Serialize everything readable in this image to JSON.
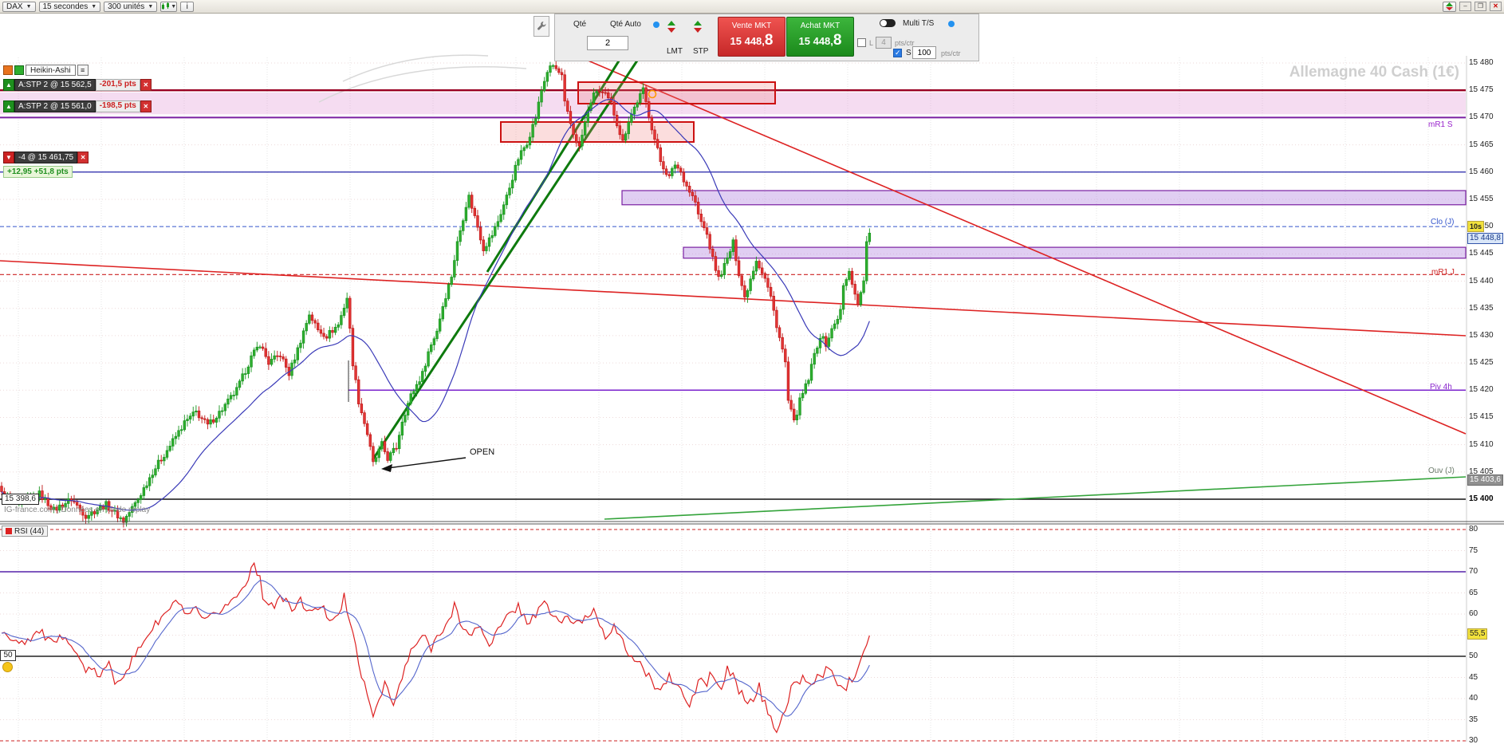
{
  "toolbar": {
    "symbol": "DAX",
    "timeframe": "15 secondes",
    "units": "300 unités",
    "info_button": "i"
  },
  "window_controls": {
    "minimize": "–",
    "restore": "❐",
    "close": "✕"
  },
  "trade_panel": {
    "qty_label": "Qté",
    "qty_value": "2",
    "qty_auto_label": "Qté Auto",
    "lmt_label": "LMT",
    "stp_label": "STP",
    "sell_button": {
      "label": "Vente MKT",
      "price": "15 448,",
      "price_big": "8"
    },
    "buy_button": {
      "label": "Achat MKT",
      "price": "15 448,",
      "price_big": "8"
    },
    "limit": {
      "label": "L",
      "value": "4",
      "unit": "pts/ctr"
    },
    "multi_ts_label": "Multi T/S",
    "stop": {
      "label": "S",
      "value": "100",
      "unit": "pts/ctr"
    }
  },
  "chart": {
    "style_button": "Heikin-Ashi",
    "watermark": "Allemagne 40 Cash (1€)",
    "positions": [
      {
        "label": "A:STP 2 @ 15 562,5",
        "pnl": "-201,5 pts"
      },
      {
        "label": "A:STP 2 @ 15 561,0",
        "pnl": "-198,5 pts"
      }
    ],
    "closed_position": "-4 @ 15 461,75",
    "session_pnl": "+12,95 +51,8 pts",
    "open_label": "OPEN",
    "left_price_box": "15 398,6",
    "countdown": "10s",
    "last_price": "15 448,8",
    "open_price": "15 403,6",
    "footer": "IG-france.com | Données en mode replay",
    "labels": {
      "mr1s": "mR1 S",
      "clo": "Clo (J)",
      "mr1j": "mR1 J",
      "piv": "Piv 4h",
      "ouv": "Ouv (J)"
    }
  },
  "rsi_panel": {
    "label": "RSI (44)",
    "left_level": "50",
    "current": "55,5"
  },
  "chart_data": {
    "type": "candlestick",
    "title": "Allemagne 40 Cash (1€) — DAX 15 secondes Heikin-Ashi 300 unités with RSI(44)",
    "price_ticks": [
      15480,
      15475,
      15470,
      15465,
      15460,
      15455,
      15450,
      15445,
      15440,
      15435,
      15430,
      15425,
      15420,
      15415,
      15410,
      15405,
      15400
    ],
    "rsi_ticks": [
      80,
      75,
      70,
      65,
      60,
      55,
      50,
      45,
      40,
      35,
      30
    ],
    "candle_count": 300,
    "levels": {
      "dark_red": 15475,
      "mr1_s": 15470,
      "blue": 15460,
      "clo_j": 15450,
      "last": 15448.8,
      "mr1_j": 15441.2,
      "piv_4h": 15420,
      "ouv_j": 15403.6,
      "black": 15400
    },
    "rsi_levels": {
      "upper_red": 80,
      "purple": 70,
      "mid": 50,
      "lower_red": 30,
      "current": 55.5
    },
    "price_path": [
      [
        0,
        15401
      ],
      [
        6,
        15399
      ],
      [
        13,
        15401
      ],
      [
        18,
        15398
      ],
      [
        24,
        15400
      ],
      [
        29,
        15397
      ],
      [
        36,
        15399
      ],
      [
        42,
        15396
      ],
      [
        47,
        15400
      ],
      [
        52,
        15405
      ],
      [
        57,
        15409
      ],
      [
        63,
        15414
      ],
      [
        67,
        15416
      ],
      [
        71,
        15413.5
      ],
      [
        76,
        15416.5
      ],
      [
        81,
        15420
      ],
      [
        86,
        15426
      ],
      [
        89,
        15428.5
      ],
      [
        92,
        15425
      ],
      [
        96,
        15426.5
      ],
      [
        99,
        15423
      ],
      [
        102,
        15427.5
      ],
      [
        106,
        15434
      ],
      [
        109,
        15431
      ],
      [
        112,
        15430
      ],
      [
        116,
        15432
      ],
      [
        119,
        15437
      ],
      [
        121,
        15425
      ],
      [
        123,
        15418
      ],
      [
        126,
        15412
      ],
      [
        128,
        15406.5
      ],
      [
        131,
        15410
      ],
      [
        133,
        15407.5
      ],
      [
        136,
        15409.5
      ],
      [
        138,
        15414.5
      ],
      [
        141,
        15419
      ],
      [
        145,
        15423
      ],
      [
        147,
        15427
      ],
      [
        150,
        15431
      ],
      [
        152,
        15435.5
      ],
      [
        155,
        15441
      ],
      [
        157,
        15447
      ],
      [
        160,
        15454
      ],
      [
        161,
        15455.5
      ],
      [
        164,
        15450
      ],
      [
        166,
        15446
      ],
      [
        169,
        15448.5
      ],
      [
        171,
        15451
      ],
      [
        174,
        15455.5
      ],
      [
        176,
        15459
      ],
      [
        178,
        15462.5
      ],
      [
        181,
        15465.5
      ],
      [
        184,
        15470
      ],
      [
        186,
        15475
      ],
      [
        188,
        15478.5
      ],
      [
        190,
        15479.5
      ],
      [
        193,
        15477.5
      ],
      [
        194,
        15472.5
      ],
      [
        197,
        15467
      ],
      [
        199,
        15464.5
      ],
      [
        201,
        15469
      ],
      [
        203,
        15473
      ],
      [
        205,
        15475
      ],
      [
        208,
        15474
      ],
      [
        210,
        15472.5
      ],
      [
        212,
        15469
      ],
      [
        214,
        15465.5
      ],
      [
        216,
        15469.5
      ],
      [
        219,
        15473
      ],
      [
        221,
        15475
      ],
      [
        223,
        15470.5
      ],
      [
        225,
        15466
      ],
      [
        227,
        15462
      ],
      [
        230,
        15459
      ],
      [
        232,
        15461.5
      ],
      [
        234,
        15460
      ],
      [
        236,
        15457.5
      ],
      [
        239,
        15454.5
      ],
      [
        240,
        15452
      ],
      [
        243,
        15448.5
      ],
      [
        245,
        15444
      ],
      [
        247,
        15440.5
      ],
      [
        250,
        15444
      ],
      [
        252,
        15447
      ],
      [
        254,
        15441.5
      ],
      [
        256,
        15437
      ],
      [
        258,
        15440.5
      ],
      [
        260,
        15444
      ],
      [
        263,
        15440.5
      ],
      [
        265,
        15437
      ],
      [
        267,
        15432
      ],
      [
        270,
        15425
      ],
      [
        271,
        15418
      ],
      [
        273,
        15414
      ],
      [
        275,
        15418
      ],
      [
        278,
        15422
      ],
      [
        280,
        15426.5
      ],
      [
        282,
        15430
      ],
      [
        284,
        15428.5
      ],
      [
        286,
        15431
      ],
      [
        289,
        15434.5
      ],
      [
        290,
        15439
      ],
      [
        292,
        15441.5
      ],
      [
        294,
        15438
      ],
      [
        295,
        15435.5
      ],
      [
        297,
        15440.5
      ],
      [
        298,
        15446.8
      ],
      [
        299,
        15449
      ]
    ],
    "rsi_path": [
      [
        0,
        55
      ],
      [
        8,
        53.5
      ],
      [
        13,
        56
      ],
      [
        18,
        52.5
      ],
      [
        22,
        55.5
      ],
      [
        26,
        50
      ],
      [
        29,
        47
      ],
      [
        34,
        45.5
      ],
      [
        37,
        48
      ],
      [
        39,
        44
      ],
      [
        42,
        46
      ],
      [
        46,
        50
      ],
      [
        50,
        55
      ],
      [
        55,
        59
      ],
      [
        59,
        62
      ],
      [
        61,
        63
      ],
      [
        64,
        59
      ],
      [
        67,
        61
      ],
      [
        70,
        58
      ],
      [
        74,
        60
      ],
      [
        77,
        62
      ],
      [
        80,
        63.5
      ],
      [
        83,
        66
      ],
      [
        85,
        69
      ],
      [
        87,
        72.5
      ],
      [
        89,
        68
      ],
      [
        90,
        64
      ],
      [
        94,
        62
      ],
      [
        97,
        64
      ],
      [
        100,
        61
      ],
      [
        103,
        63
      ],
      [
        107,
        60
      ],
      [
        110,
        62
      ],
      [
        113,
        59
      ],
      [
        117,
        61
      ],
      [
        118,
        64
      ],
      [
        120,
        58
      ],
      [
        122,
        52
      ],
      [
        124,
        46
      ],
      [
        126,
        40
      ],
      [
        128,
        36
      ],
      [
        130,
        40
      ],
      [
        132,
        44
      ],
      [
        134,
        40
      ],
      [
        135,
        38
      ],
      [
        137,
        43
      ],
      [
        139,
        47
      ],
      [
        141,
        51
      ],
      [
        145,
        55
      ],
      [
        148,
        52
      ],
      [
        151,
        56
      ],
      [
        155,
        59
      ],
      [
        156,
        62
      ],
      [
        158,
        58
      ],
      [
        161,
        55
      ],
      [
        165,
        57
      ],
      [
        168,
        53
      ],
      [
        171,
        56
      ],
      [
        174,
        59
      ],
      [
        178,
        62
      ],
      [
        181,
        58
      ],
      [
        184,
        60
      ],
      [
        188,
        63
      ],
      [
        189,
        60
      ],
      [
        193,
        58
      ],
      [
        195,
        60
      ],
      [
        197,
        57
      ],
      [
        201,
        59
      ],
      [
        204,
        61
      ],
      [
        206,
        58
      ],
      [
        208,
        55
      ],
      [
        211,
        57
      ],
      [
        214,
        53
      ],
      [
        217,
        50
      ],
      [
        221,
        47
      ],
      [
        224,
        44
      ],
      [
        227,
        42
      ],
      [
        230,
        45
      ],
      [
        234,
        42
      ],
      [
        236,
        39
      ],
      [
        237,
        38
      ],
      [
        239,
        42
      ],
      [
        241,
        45
      ],
      [
        243,
        43
      ],
      [
        244,
        46
      ],
      [
        246,
        44
      ],
      [
        248,
        42
      ],
      [
        250,
        47
      ],
      [
        252,
        45
      ],
      [
        254,
        42
      ],
      [
        256,
        40
      ],
      [
        257,
        38
      ],
      [
        259,
        40
      ],
      [
        261,
        43
      ],
      [
        262,
        40
      ],
      [
        264,
        37
      ],
      [
        266,
        34
      ],
      [
        267,
        33
      ],
      [
        269,
        36
      ],
      [
        271,
        39
      ],
      [
        272,
        42
      ],
      [
        274,
        44
      ],
      [
        276,
        45
      ],
      [
        278,
        43
      ],
      [
        281,
        45
      ],
      [
        285,
        47
      ],
      [
        288,
        44
      ],
      [
        290,
        42
      ],
      [
        292,
        44
      ],
      [
        294,
        46
      ],
      [
        295,
        48
      ],
      [
        296,
        50
      ],
      [
        298,
        53
      ],
      [
        299,
        55.5
      ]
    ]
  }
}
